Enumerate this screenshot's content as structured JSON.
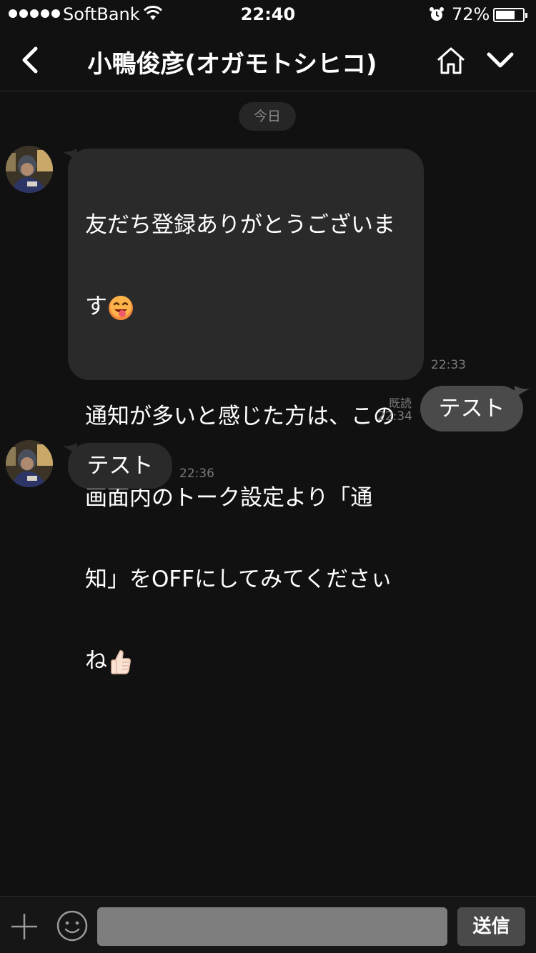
{
  "status_bar": {
    "carrier": "SoftBank",
    "time": "22:40",
    "battery_percent": "72%",
    "battery_level": 0.72,
    "icons": [
      "signal-dots-icon",
      "wifi-icon",
      "alarm-icon",
      "battery-icon"
    ]
  },
  "header": {
    "title": "小鴨俊彦(オガモトシヒコ)",
    "icons": [
      "back-icon",
      "home-icon",
      "chevron-down-icon"
    ]
  },
  "date_divider": "今日",
  "messages": [
    {
      "direction": "incoming",
      "paragraph1_line1": "友だち登録ありがとうございま",
      "paragraph1_line2": "す",
      "paragraph2_line1": "通知が多いと感じた方は、この",
      "paragraph2_line2": "画面内のトーク設定より「通",
      "paragraph2_line3": "知」をOFFにしてみてくださぃ",
      "paragraph2_line4": "ね",
      "emojis": [
        "tongue-out-face-emoji",
        "thumbs-up-emoji"
      ],
      "time": "22:33"
    },
    {
      "direction": "outgoing",
      "text": "テスト",
      "read_label": "既読",
      "time": "22:34"
    },
    {
      "direction": "incoming",
      "text": "テスト",
      "time": "22:36"
    }
  ],
  "input_bar": {
    "placeholder": "",
    "send_label": "送信"
  },
  "colors": {
    "background": "#111111",
    "incoming_bubble": "#2a2a2a",
    "outgoing_bubble": "#4a4a4a",
    "timestamp": "#7a7a7a"
  }
}
